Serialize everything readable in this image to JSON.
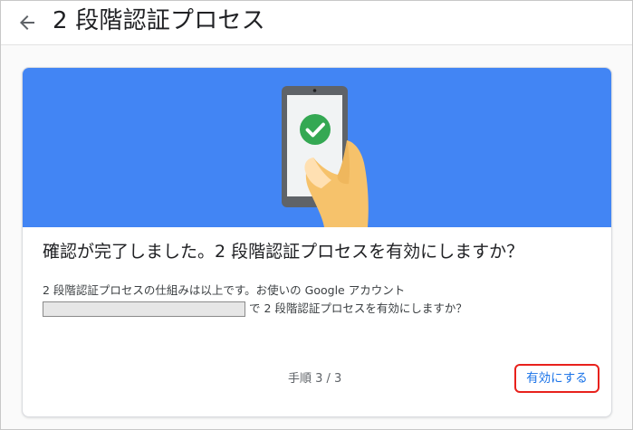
{
  "header": {
    "title": "2 段階認証プロセス",
    "back_icon": "arrow-left-icon"
  },
  "colors": {
    "banner": "#4285f4",
    "accent": "#1a73e8",
    "highlight_border": "#e8211c",
    "check_green": "#34a853"
  },
  "card": {
    "illustration": {
      "icons": [
        "phone-icon",
        "checkmark-icon",
        "hand-icon"
      ]
    },
    "question": "確認が完了しました。2 段階認証プロセスを有効にしますか？",
    "description_line1": "2 段階認証プロセスの仕組みは以上です。お使いの Google アカウント",
    "description_line2": "で 2 段階認証プロセスを有効にしますか？",
    "step": "手順 3 / 3",
    "enable_label": "有効にする"
  }
}
